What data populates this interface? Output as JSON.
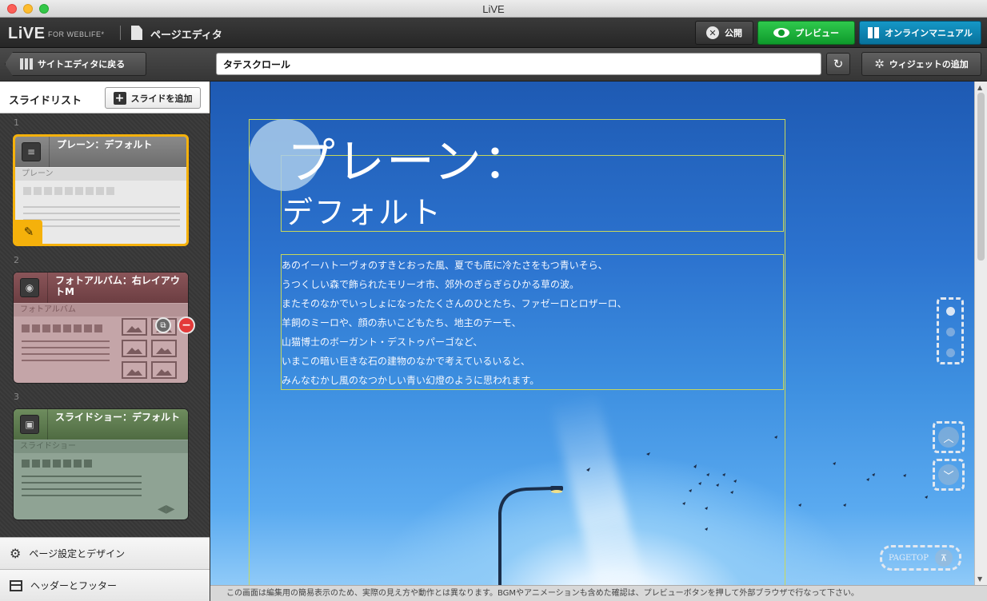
{
  "window": {
    "title": "LiVE"
  },
  "app": {
    "logo": "LiVE",
    "logo_sub": "FOR WEBLIFE*",
    "editor_title": "ページエディタ",
    "publish_label": "公開",
    "preview_label": "プレビュー",
    "manual_label": "オンラインマニュアル"
  },
  "toolbar": {
    "back_label": "サイトエディタに戻る",
    "page_title_value": "タテスクロール",
    "widget_label": "ウィジェットの追加"
  },
  "sidebar": {
    "list_title": "スライドリスト",
    "add_slide_label": "スライドを追加",
    "slides": [
      {
        "number": "1",
        "title": "プレーン：デフォルト",
        "type": "プレーン",
        "selected": true
      },
      {
        "number": "2",
        "title": "フォトアルバム：右レイアウトM",
        "type": "フォトアルバム",
        "selected": false
      },
      {
        "number": "3",
        "title": "スライドショー：デフォルト",
        "type": "スライドショー",
        "selected": false
      }
    ],
    "footer": {
      "page_settings": "ページ設定とデザイン",
      "header_footer": "ヘッダーとフッター"
    }
  },
  "canvas": {
    "title_line1": "プレーン：",
    "title_line2": "デフォルト",
    "body_lines": [
      "あのイーハトーヴォのすきとおった風、夏でも底に冷たさをもつ青いそら、",
      "うつくしい森で飾られたモリーオ市、郊外のぎらぎらひかる草の波。",
      "またそのなかでいっしょになったたくさんのひとたち、ファゼーロとロザーロ、",
      "羊飼のミーロや、顔の赤いこどもたち、地主のテーモ、",
      "山猫博士のボーガント・デストゥパーゴなど、",
      "いまこの暗い巨きな石の建物のなかで考えているいると、",
      "みんなむかし風のなつかしい青い幻燈のように思われます。"
    ],
    "pagetop_label": "PAGETOP",
    "active_dot": 1
  },
  "status": {
    "message": "この画面は編集用の簡易表示のため、実際の見え方や動作とは異なります。BGMやアニメーションも含めた確認は、プレビューボタンを押して外部ブラウザで行なって下さい。"
  },
  "colors": {
    "selected_border": "#f5b10b",
    "preview_green": "#0e9a2b",
    "manual_blue": "#07729c",
    "delete_red": "#e33a3a"
  }
}
